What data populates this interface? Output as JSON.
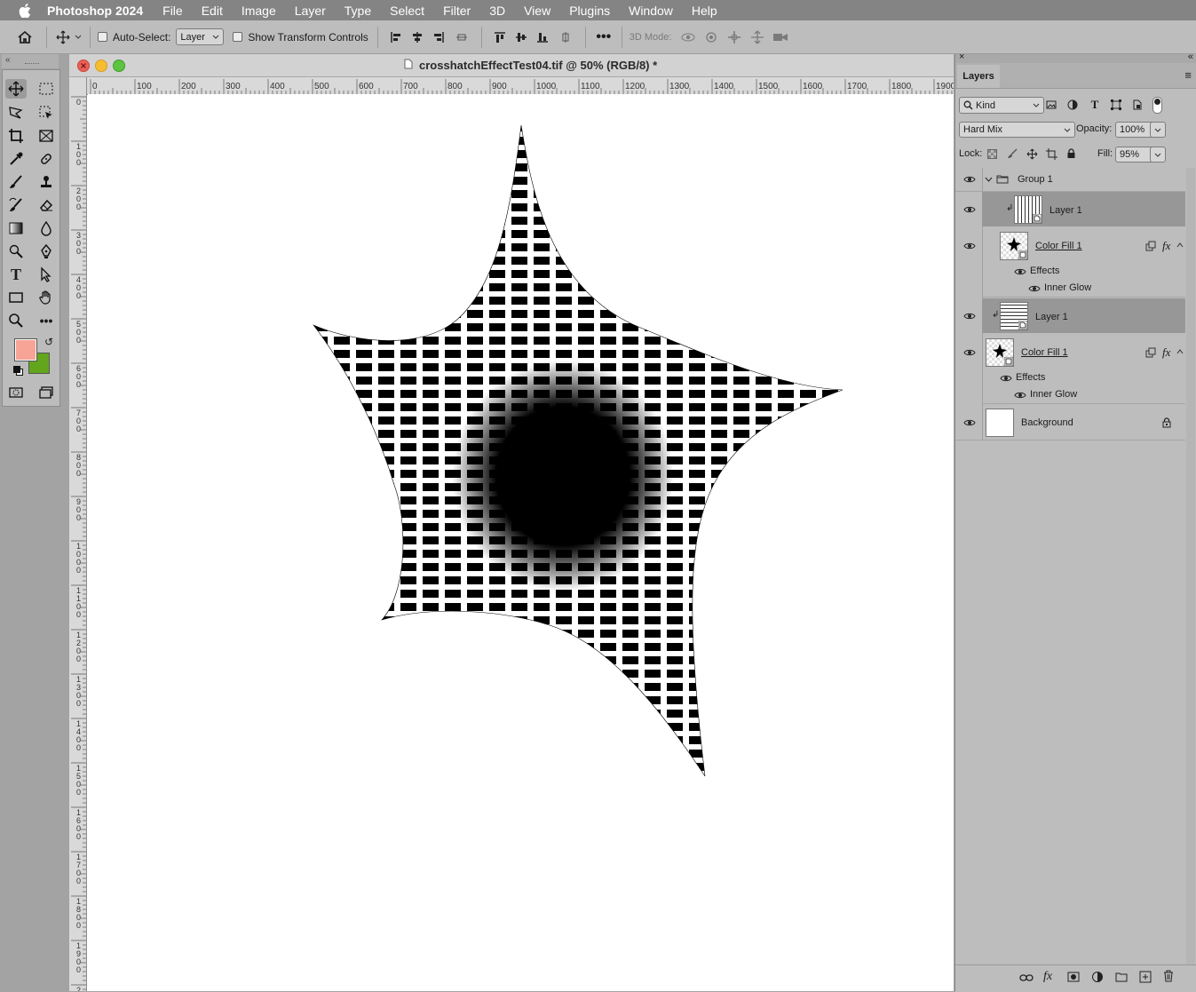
{
  "menubar": {
    "app_name": "Photoshop 2024",
    "items": [
      "File",
      "Edit",
      "Image",
      "Layer",
      "Type",
      "Select",
      "Filter",
      "3D",
      "View",
      "Plugins",
      "Window",
      "Help"
    ]
  },
  "options_bar": {
    "auto_select_label": "Auto-Select:",
    "auto_select_value": "Layer",
    "show_transform_label": "Show Transform Controls",
    "mode_3d_label": "3D Mode:"
  },
  "document": {
    "title": "crosshatchEffectTest04.tif @ 50% (RGB/8) *",
    "hruler_ticks": [
      "0",
      "100",
      "200",
      "300",
      "400",
      "500",
      "600",
      "700",
      "800",
      "900",
      "1000",
      "1100",
      "1200",
      "1300",
      "1400",
      "1500",
      "1600",
      "1700",
      "1800",
      "1900"
    ],
    "vruler_ticks": [
      "0",
      "100",
      "200",
      "300",
      "400",
      "500",
      "600",
      "700",
      "800",
      "900",
      "1000",
      "1100",
      "1200",
      "1300",
      "1400",
      "1500",
      "1600",
      "1700",
      "1800",
      "1900",
      "2"
    ]
  },
  "colors": {
    "foreground": "#f7a395",
    "background": "#64a51e"
  },
  "layers_panel": {
    "tab_label": "Layers",
    "filter_kind": "Kind",
    "blend_mode": "Hard Mix",
    "opacity_label": "Opacity:",
    "opacity_value": "100%",
    "lock_label": "Lock:",
    "fill_label": "Fill:",
    "fill_value": "95%",
    "layers": [
      {
        "name": "Group 1",
        "type": "group"
      },
      {
        "name": "Layer 1",
        "type": "pattern",
        "selected": true
      },
      {
        "name": "Color Fill 1",
        "type": "fill",
        "effects_label": "Effects",
        "effect": "Inner Glow"
      },
      {
        "name": "Layer 1",
        "type": "pattern",
        "selected": true
      },
      {
        "name": "Color Fill 1",
        "type": "fill",
        "effects_label": "Effects",
        "effect": "Inner Glow"
      },
      {
        "name": "Background",
        "type": "background"
      }
    ]
  }
}
